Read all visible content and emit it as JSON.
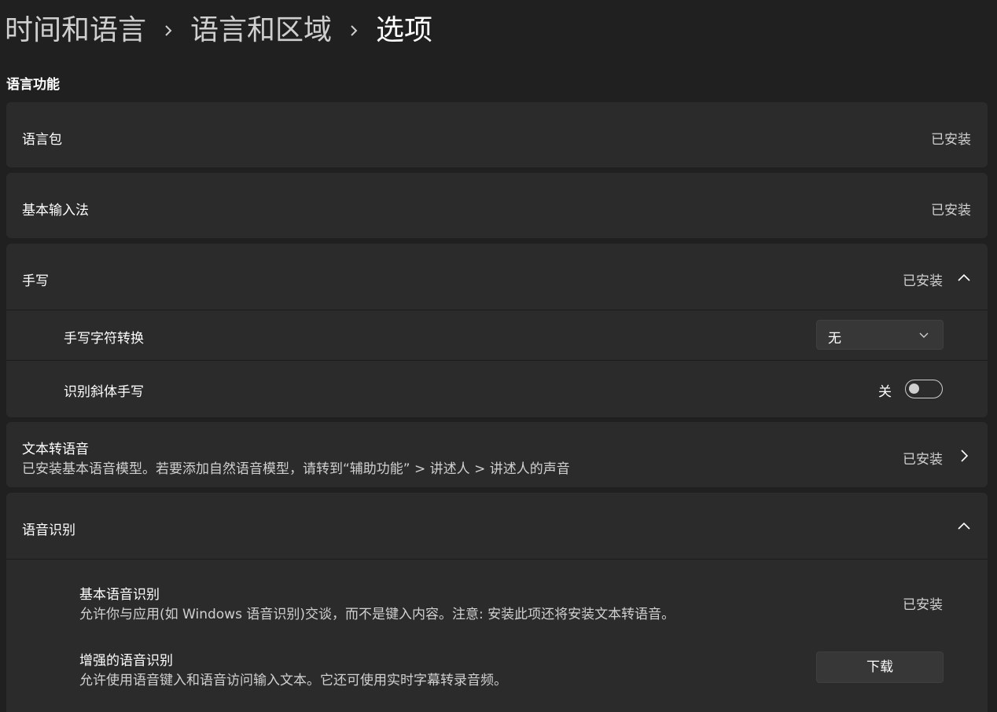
{
  "breadcrumb": {
    "items": [
      "时间和语言",
      "语言和区域",
      "选项"
    ]
  },
  "section": {
    "title": "语言功能"
  },
  "language_pack": {
    "label": "语言包",
    "status": "已安装"
  },
  "basic_typing": {
    "label": "基本输入法",
    "status": "已安装"
  },
  "handwriting": {
    "label": "手写",
    "status": "已安装",
    "expanded": true,
    "char_conversion": {
      "label": "手写字符转换",
      "dropdown": {
        "selected": "无"
      }
    },
    "recognize_italic": {
      "label": "识别斜体手写",
      "toggle": {
        "state_text": "关",
        "on": false
      }
    }
  },
  "tts": {
    "label": "文本转语音",
    "description": "已安装基本语音模型。若要添加自然语音模型，请转到“辅助功能” > 讲述人 > 讲述人的声音",
    "status": "已安装"
  },
  "speech_recognition": {
    "label": "语音识别",
    "expanded": true,
    "basic": {
      "label": "基本语音识别",
      "description": "允许你与应用(如 Windows 语音识别)交谈，而不是键入内容。注意: 安装此项还将安装文本转语音。",
      "status": "已安装"
    },
    "enhanced": {
      "label": "增强的语音识别",
      "description": "允许使用语音键入和语音访问输入文本。它还可使用实时字幕转录音频。",
      "button": "下载"
    }
  },
  "icons": {
    "breadcrumb_separator": "chevron-right-icon",
    "collapse": "chevron-up-icon",
    "navigate": "chevron-right-icon",
    "dropdown": "chevron-down-icon"
  },
  "colors": {
    "background": "#202020",
    "card": "#2b2b2b",
    "control": "#373737"
  }
}
